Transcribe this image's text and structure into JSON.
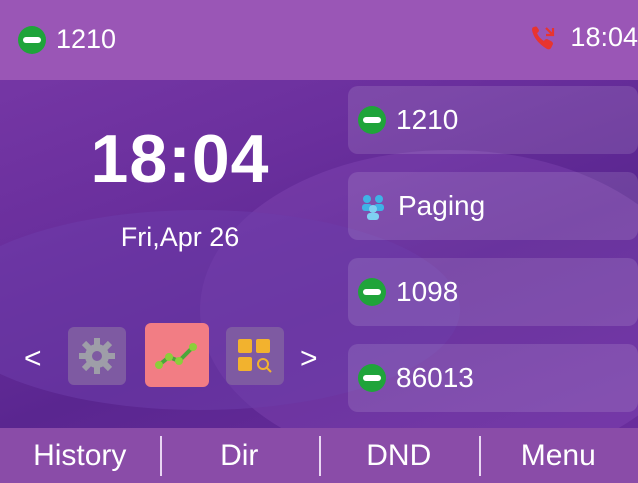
{
  "status_bar": {
    "account": "1210",
    "time": "18:04",
    "missed_call_icon": "missed-call-icon",
    "colors": {
      "bar": "#9a56b6",
      "missed": "#e8342f"
    }
  },
  "home": {
    "time": "18:04",
    "date": "Fri,Apr 26",
    "prev_label": "<",
    "next_label": ">"
  },
  "app_icons": [
    {
      "name": "settings-icon"
    },
    {
      "name": "chart-app-icon",
      "selected": true
    },
    {
      "name": "directory-search-icon"
    }
  ],
  "line_keys": [
    {
      "label": "1210",
      "icon": "line-phone-icon"
    },
    {
      "label": "Paging",
      "icon": "paging-icon"
    },
    {
      "label": "1098",
      "icon": "line-phone-icon"
    },
    {
      "label": "86013",
      "icon": "line-phone-icon"
    }
  ],
  "softkeys": [
    "History",
    "Dir",
    "DND",
    "Menu"
  ]
}
